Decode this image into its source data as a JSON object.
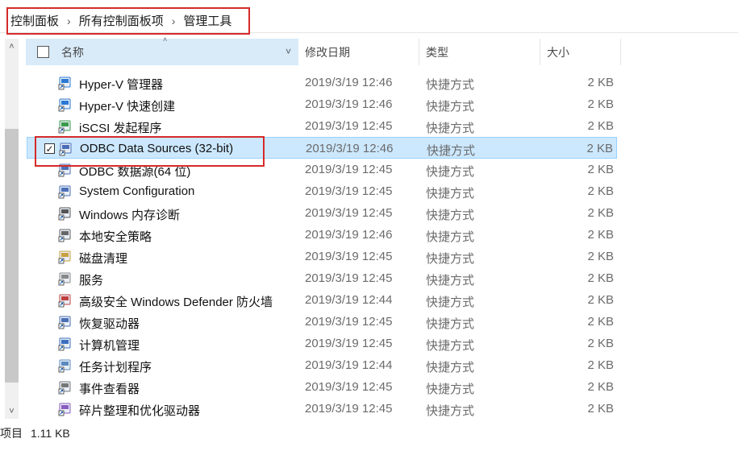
{
  "breadcrumb": [
    "控制面板",
    "所有控制面板项",
    "管理工具"
  ],
  "columns": {
    "name": "名称",
    "date": "修改日期",
    "type": "类型",
    "size": "大小"
  },
  "rows": [
    {
      "name": "Hyper-V 管理器",
      "date": "2019/3/19 12:46",
      "type": "快捷方式",
      "size": "2 KB",
      "icon": "hyperv-manager-icon"
    },
    {
      "name": "Hyper-V 快速创建",
      "date": "2019/3/19 12:46",
      "type": "快捷方式",
      "size": "2 KB",
      "icon": "hyperv-quick-create-icon"
    },
    {
      "name": "iSCSI 发起程序",
      "date": "2019/3/19 12:45",
      "type": "快捷方式",
      "size": "2 KB",
      "icon": "iscsi-initiator-icon"
    },
    {
      "name": "ODBC Data Sources (32-bit)",
      "date": "2019/3/19 12:46",
      "type": "快捷方式",
      "size": "2 KB",
      "icon": "odbc-32-icon",
      "selected": true
    },
    {
      "name": "ODBC 数据源(64 位)",
      "date": "2019/3/19 12:45",
      "type": "快捷方式",
      "size": "2 KB",
      "icon": "odbc-64-icon"
    },
    {
      "name": "System Configuration",
      "date": "2019/3/19 12:45",
      "type": "快捷方式",
      "size": "2 KB",
      "icon": "system-configuration-icon"
    },
    {
      "name": "Windows 内存诊断",
      "date": "2019/3/19 12:45",
      "type": "快捷方式",
      "size": "2 KB",
      "icon": "memory-diagnostic-icon"
    },
    {
      "name": "本地安全策略",
      "date": "2019/3/19 12:46",
      "type": "快捷方式",
      "size": "2 KB",
      "icon": "local-security-policy-icon"
    },
    {
      "name": "磁盘清理",
      "date": "2019/3/19 12:45",
      "type": "快捷方式",
      "size": "2 KB",
      "icon": "disk-cleanup-icon"
    },
    {
      "name": "服务",
      "date": "2019/3/19 12:45",
      "type": "快捷方式",
      "size": "2 KB",
      "icon": "services-icon"
    },
    {
      "name": "高级安全 Windows Defender 防火墙",
      "date": "2019/3/19 12:44",
      "type": "快捷方式",
      "size": "2 KB",
      "icon": "firewall-icon"
    },
    {
      "name": "恢复驱动器",
      "date": "2019/3/19 12:45",
      "type": "快捷方式",
      "size": "2 KB",
      "icon": "recovery-drive-icon"
    },
    {
      "name": "计算机管理",
      "date": "2019/3/19 12:45",
      "type": "快捷方式",
      "size": "2 KB",
      "icon": "computer-management-icon"
    },
    {
      "name": "任务计划程序",
      "date": "2019/3/19 12:44",
      "type": "快捷方式",
      "size": "2 KB",
      "icon": "task-scheduler-icon"
    },
    {
      "name": "事件查看器",
      "date": "2019/3/19 12:45",
      "type": "快捷方式",
      "size": "2 KB",
      "icon": "event-viewer-icon"
    },
    {
      "name": "碎片整理和优化驱动器",
      "date": "2019/3/19 12:45",
      "type": "快捷方式",
      "size": "2 KB",
      "icon": "defragment-icon"
    }
  ],
  "status": {
    "items": "项目",
    "size": "1.11 KB"
  },
  "colors": {
    "selection": "#cce8ff",
    "highlight": "#d62a2a",
    "header_active": "#d9ebf9"
  }
}
